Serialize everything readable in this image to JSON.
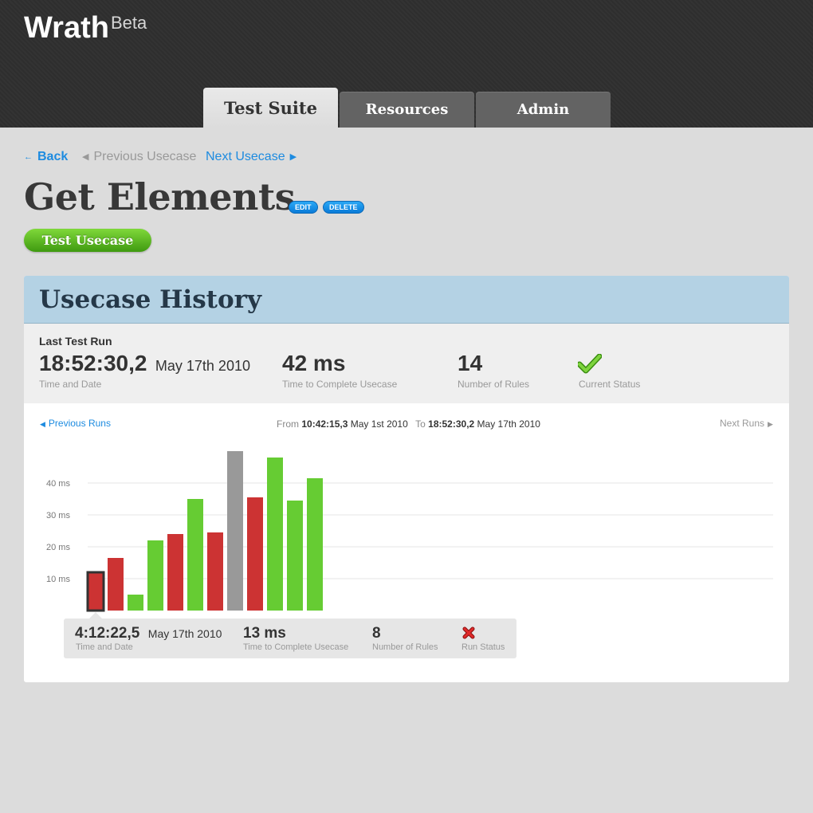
{
  "app": {
    "name": "Wrath",
    "badge": "Beta"
  },
  "tabs": [
    {
      "label": "Test Suite",
      "active": true
    },
    {
      "label": "Resources",
      "active": false
    },
    {
      "label": "Admin",
      "active": false
    }
  ],
  "nav": {
    "back": "Back",
    "back_icon": "left-arrow",
    "previous": "Previous Usecase",
    "next": "Next Usecase"
  },
  "usecase": {
    "title": "Get Elements",
    "edit": "EDIT",
    "delete": "DELETE",
    "test_button": "Test Usecase"
  },
  "history": {
    "title": "Usecase History",
    "last_run": {
      "heading": "Last Test Run",
      "time": "18:52:30,2",
      "date": "May 17th 2010",
      "time_caption": "Time and Date",
      "duration": "42 ms",
      "duration_caption": "Time to Complete Usecase",
      "rules": "14",
      "rules_caption": "Number of Rules",
      "status_caption": "Current Status",
      "status_icon": "check-icon"
    },
    "runs_nav": {
      "previous": "Previous Runs",
      "next": "Next Runs",
      "from_label": "From",
      "from_time": "10:42:15,3",
      "from_date": "May 1st 2010",
      "to_label": "To",
      "to_time": "18:52:30,2",
      "to_date": "May 17th 2010"
    },
    "tooltip": {
      "time": "4:12:22,5",
      "date": "May 17th 2010",
      "time_caption": "Time and Date",
      "duration": "13 ms",
      "duration_caption": "Time to Complete Usecase",
      "rules": "8",
      "rules_caption": "Number of Rules",
      "status_caption": "Run Status",
      "status_icon": "cross-icon"
    }
  },
  "colors": {
    "pass": "#66cc33",
    "fail": "#cc3333",
    "unknown": "#999999",
    "link": "#1d8be0",
    "header_bg": "#2e2e2e",
    "panel_head": "#b4d2e4"
  },
  "chart_data": {
    "type": "bar",
    "ylabel": "",
    "y_ticks": [
      10,
      20,
      30,
      40
    ],
    "y_tick_labels": [
      "10 ms",
      "20 ms",
      "30 ms",
      "40 ms"
    ],
    "ylim": [
      0,
      50
    ],
    "grid": true,
    "unit": "ms",
    "values": [
      12,
      16.5,
      5,
      22,
      24,
      35,
      24.5,
      50,
      35.5,
      48,
      34.5,
      41.5
    ],
    "status": [
      "fail",
      "fail",
      "pass",
      "pass",
      "fail",
      "pass",
      "fail",
      "unknown",
      "fail",
      "pass",
      "pass",
      "pass"
    ],
    "selected_index": 0
  }
}
